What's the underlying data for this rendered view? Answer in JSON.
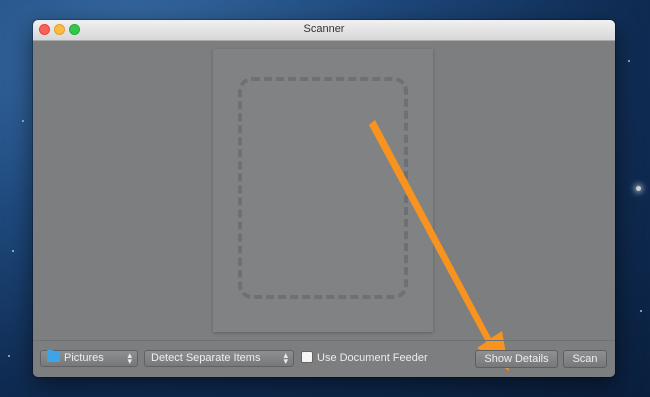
{
  "window": {
    "title": "Scanner"
  },
  "toolbar": {
    "destination": {
      "value": "Pictures",
      "icon": "folder-icon"
    },
    "scan_mode": {
      "value": "Detect Separate Items"
    },
    "document_feeder": {
      "label": "Use Document Feeder",
      "checked": false
    },
    "show_details_label": "Show Details",
    "scan_label": "Scan"
  },
  "colors": {
    "annotation_arrow": "#f7931e"
  }
}
